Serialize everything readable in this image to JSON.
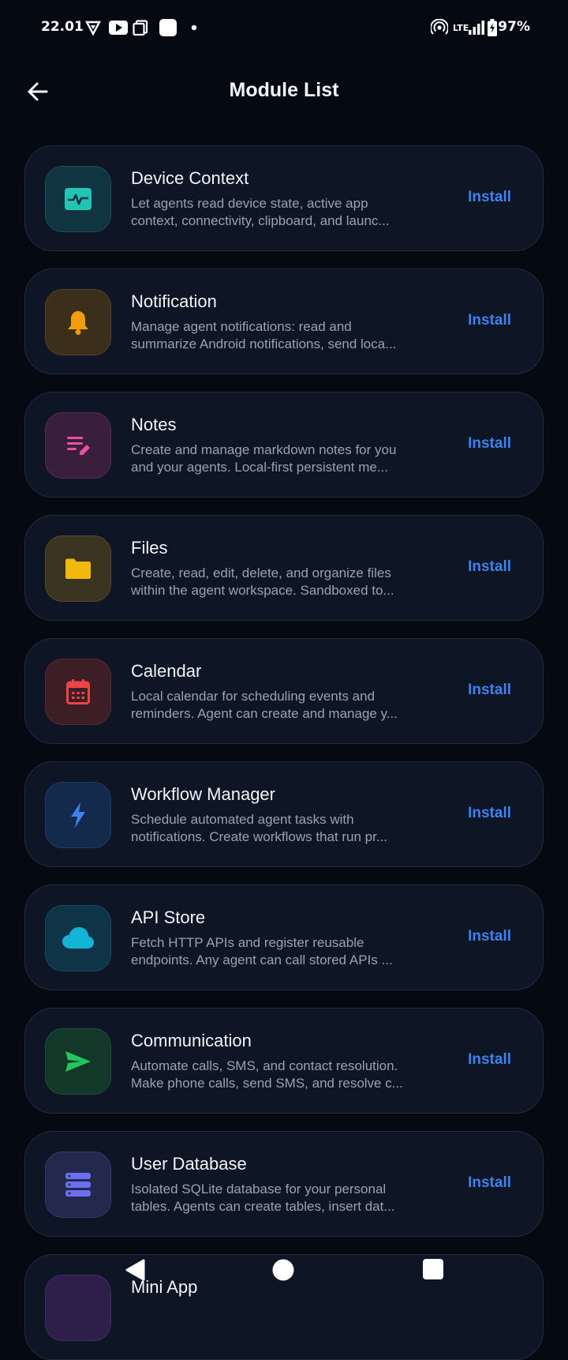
{
  "status_bar": {
    "time": "22.01",
    "network": "LTE",
    "battery": "97%"
  },
  "app_bar": {
    "title": "Module List"
  },
  "modules": [
    {
      "title": "Device Context",
      "desc": "Let agents read device state, active app\ncontext, connectivity, clipboard, and launc...",
      "action": "Install",
      "icon": "activity-icon",
      "tile_bg": "#0f3640",
      "tile_border": "#1b4e58",
      "icon_color": "#22c4b4"
    },
    {
      "title": "Notification",
      "desc": "Manage agent notifications: read and\nsummarize Android notifications, send loca...",
      "action": "Install",
      "icon": "bell-icon",
      "tile_bg": "#3b2f1c",
      "tile_border": "#54432a",
      "icon_color": "#f29e0c"
    },
    {
      "title": "Notes",
      "desc": "Create and manage markdown notes for you\nand your agents. Local-first persistent me...",
      "action": "Install",
      "icon": "note-edit-icon",
      "tile_bg": "#3a1f3d",
      "tile_border": "#522c56",
      "icon_color": "#e94fa3"
    },
    {
      "title": "Files",
      "desc": "Create, read, edit, delete, and organize files\nwithin the agent workspace. Sandboxed to...",
      "action": "Install",
      "icon": "folder-icon",
      "tile_bg": "#3b3420",
      "tile_border": "#54492c",
      "icon_color": "#f2b90c"
    },
    {
      "title": "Calendar",
      "desc": "Local calendar for scheduling events and\nreminders. Agent can create and manage y...",
      "action": "Install",
      "icon": "calendar-icon",
      "tile_bg": "#3d1e27",
      "tile_border": "#562b36",
      "icon_color": "#ef4444"
    },
    {
      "title": "Workflow Manager",
      "desc": "Schedule automated agent tasks with\nnotifications. Create workflows that run pr...",
      "action": "Install",
      "icon": "lightning-icon",
      "tile_bg": "#142a4c",
      "tile_border": "#1f3c66",
      "icon_color": "#3d82f0"
    },
    {
      "title": "API Store",
      "desc": "Fetch HTTP APIs and register reusable\nendpoints. Any agent can call stored APIs ...",
      "action": "Install",
      "icon": "cloud-icon",
      "tile_bg": "#0f3448",
      "tile_border": "#1a4a60",
      "icon_color": "#12b5d6"
    },
    {
      "title": "Communication",
      "desc": "Automate calls, SMS, and contact resolution.\nMake phone calls, send SMS, and resolve c...",
      "action": "Install",
      "icon": "send-icon",
      "tile_bg": "#123829",
      "tile_border": "#1d5039",
      "icon_color": "#22c55e"
    },
    {
      "title": "User Database",
      "desc": "Isolated SQLite database for your personal\ntables. Agents can create tables, insert dat...",
      "action": "Install",
      "icon": "database-icon",
      "tile_bg": "#23284d",
      "tile_border": "#333a68",
      "icon_color": "#6c6ff2"
    },
    {
      "title": "Mini App",
      "desc": "",
      "action": "",
      "icon": "app-icon",
      "tile_bg": "#2d1f4a",
      "tile_border": "#3f2d66",
      "icon_color": "#9b6cf2"
    }
  ]
}
